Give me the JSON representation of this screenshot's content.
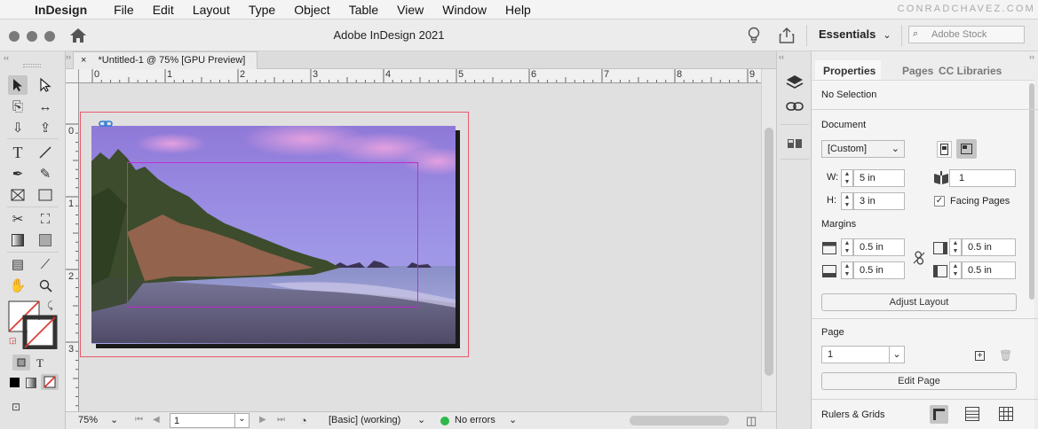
{
  "menubar": {
    "app_name": "InDesign",
    "items": [
      "File",
      "Edit",
      "Layout",
      "Type",
      "Object",
      "Table",
      "View",
      "Window",
      "Help"
    ],
    "watermark": "CONRADCHAVEZ.COM"
  },
  "appbar": {
    "title": "Adobe InDesign 2021",
    "workspace": "Essentials",
    "search_placeholder": "Adobe Stock"
  },
  "document": {
    "tab_title": "*Untitled-1 @ 75% [GPU Preview]",
    "close_glyph": "×"
  },
  "rulers": {
    "horizontal": [
      "0",
      "1",
      "2",
      "3",
      "4",
      "5",
      "6",
      "7",
      "8",
      "9"
    ],
    "vertical": [
      "0",
      "1",
      "2",
      "3"
    ]
  },
  "status": {
    "zoom": "75%",
    "page": "1",
    "profile": "[Basic] (working)",
    "preflight": "No errors"
  },
  "panel": {
    "tabs": [
      "Properties",
      "Pages",
      "CC Libraries"
    ],
    "selection": "No Selection",
    "document_heading": "Document",
    "preset": "[Custom]",
    "width_label": "W:",
    "width": "5 in",
    "height_label": "H:",
    "height": "3 in",
    "pages_count": "1",
    "facing_pages_label": "Facing Pages",
    "facing_pages_checked": true,
    "margins_heading": "Margins",
    "margin_top": "0.5 in",
    "margin_bottom": "0.5 in",
    "margin_left": "0.5 in",
    "margin_right": "0.5 in",
    "adjust_layout": "Adjust Layout",
    "page_heading": "Page",
    "page_value": "1",
    "edit_page": "Edit Page",
    "rulers_grids_heading": "Rulers & Grids"
  },
  "colors": {
    "bleed": "#e8596a",
    "margin_guide": "#c02bd0",
    "status_ok": "#2eb84a",
    "sky_top": "#9a86e0",
    "sky_pink": "#e9a0de",
    "sand": "#6d6888"
  }
}
